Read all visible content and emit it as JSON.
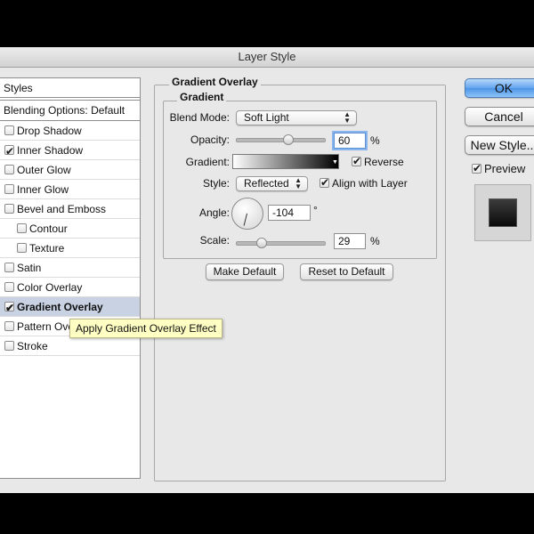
{
  "window": {
    "title": "Layer Style"
  },
  "styles_list": {
    "header": "Styles",
    "blending": "Blending Options: Default",
    "items": [
      {
        "label": "Drop Shadow",
        "checked": false,
        "selected": false
      },
      {
        "label": "Inner Shadow",
        "checked": true,
        "selected": false
      },
      {
        "label": "Outer Glow",
        "checked": false,
        "selected": false
      },
      {
        "label": "Inner Glow",
        "checked": false,
        "selected": false
      },
      {
        "label": "Bevel and Emboss",
        "checked": false,
        "selected": false
      },
      {
        "label": "Contour",
        "checked": false,
        "selected": false
      },
      {
        "label": "Texture",
        "checked": false,
        "selected": false
      },
      {
        "label": "Satin",
        "checked": false,
        "selected": false
      },
      {
        "label": "Color Overlay",
        "checked": false,
        "selected": false
      },
      {
        "label": "Gradient Overlay",
        "checked": true,
        "selected": true
      },
      {
        "label": "Pattern Ove",
        "checked": false,
        "selected": false
      },
      {
        "label": "Stroke",
        "checked": false,
        "selected": false
      }
    ],
    "tooltip": "Apply Gradient Overlay Effect"
  },
  "gradient_overlay": {
    "section_title": "Gradient Overlay",
    "group_title": "Gradient",
    "blend_mode": {
      "label": "Blend Mode:",
      "value": "Soft Light"
    },
    "opacity": {
      "label": "Opacity:",
      "value": "60",
      "unit": "%",
      "level": 0.6
    },
    "gradient": {
      "label": "Gradient:",
      "start_color": "#ffffff",
      "end_color": "#000000"
    },
    "reverse": {
      "label": "Reverse",
      "checked": true
    },
    "style": {
      "label": "Style:",
      "value": "Reflected"
    },
    "align_with_layer": {
      "label": "Align with Layer",
      "checked": true
    },
    "angle": {
      "label": "Angle:",
      "value": "-104",
      "unit": "°"
    },
    "scale": {
      "label": "Scale:",
      "value": "29",
      "unit": "%",
      "level": 0.29
    },
    "make_default": "Make Default",
    "reset_to_default": "Reset to Default"
  },
  "buttons": {
    "ok": "OK",
    "cancel": "Cancel",
    "new_style": "New Style..."
  },
  "preview": {
    "label": "Preview",
    "checked": true
  },
  "colors": {
    "accent": "#5a9ded",
    "selection": "#c8d2e3",
    "tooltip_bg": "#ffffc4"
  }
}
